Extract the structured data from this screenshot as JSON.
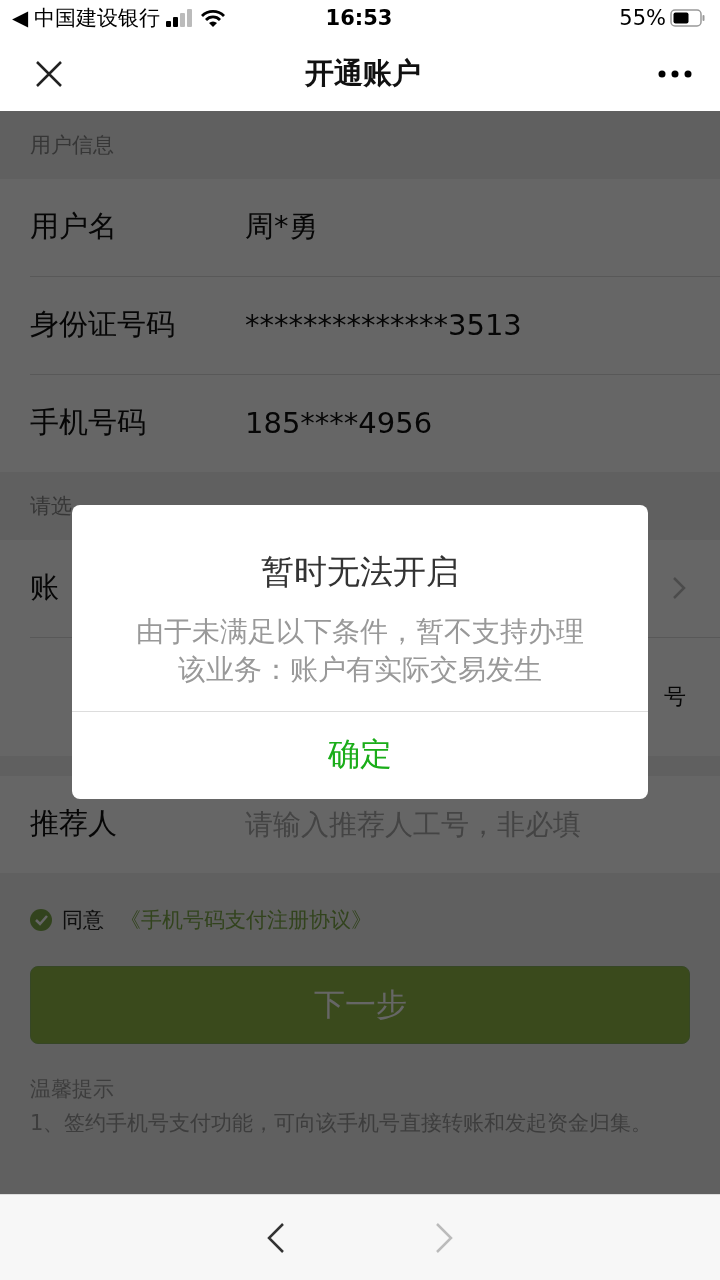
{
  "status_bar": {
    "back_arrow": "◀",
    "carrier": "中国建设银行",
    "time": "16:53",
    "battery": "55%"
  },
  "nav": {
    "title": "开通账户"
  },
  "sections": [
    {
      "header": "用户信息",
      "rows": [
        {
          "kind": "value",
          "label": "用户名",
          "value": "周*勇"
        },
        {
          "kind": "value",
          "label": "身份证号码",
          "value": "**************3513"
        },
        {
          "kind": "value",
          "label": "手机号码",
          "value": "185****4956"
        }
      ]
    },
    {
      "header": "请选",
      "rows": [
        {
          "kind": "select",
          "label": "账"
        },
        {
          "kind": "note",
          "value": "号"
        }
      ]
    },
    {
      "rows": [
        {
          "kind": "input",
          "label": "推荐人",
          "placeholder": "请输入推荐人工号，非必填"
        }
      ]
    }
  ],
  "agreement": {
    "checked": true,
    "label": "同意",
    "link": "《手机号码支付注册协议》"
  },
  "next_button": {
    "label": "下一步"
  },
  "tips": {
    "title": "温馨提示",
    "lines": [
      "1、签约手机号支付功能，可向该手机号直接转账和发起资金归集。"
    ]
  },
  "dialog": {
    "title": "暂时无法开启",
    "message": "由于未满足以下条件，暂不支持办理该业务：账户有实际交易发生",
    "button": "确定"
  },
  "toolbar": {
    "back_disabled": false,
    "forward_disabled": true
  }
}
